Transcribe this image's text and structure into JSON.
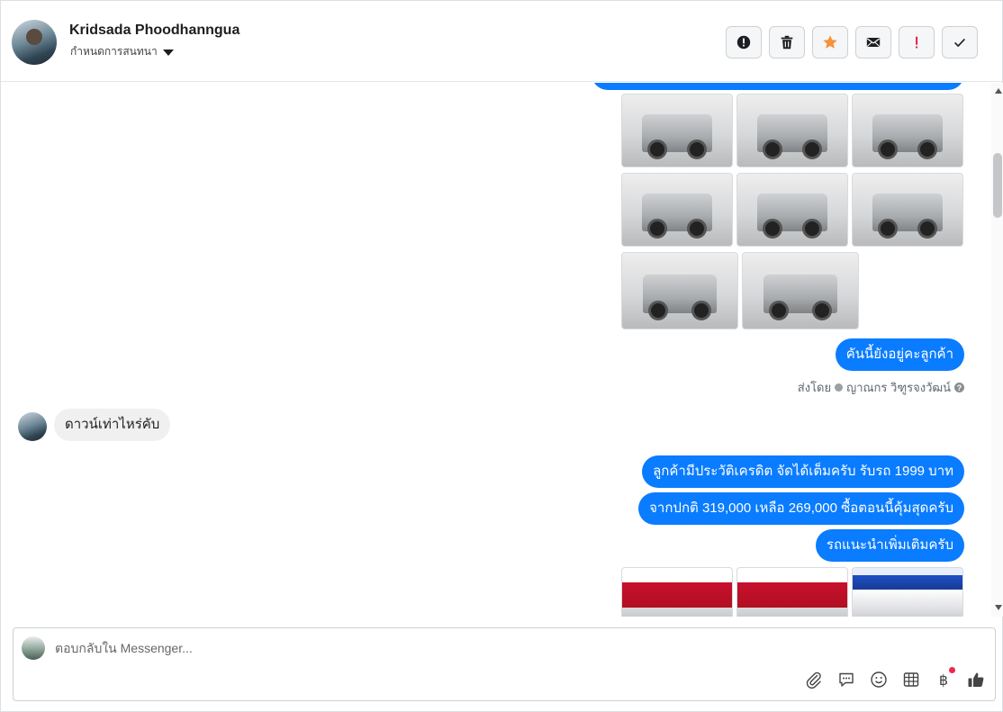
{
  "header": {
    "contact_name": "Kridsada Phoodhanngua",
    "status_label": "กำหนดการสนทนา",
    "actions": [
      {
        "name": "mark-spam-button",
        "icon": "alert-circle-icon",
        "color": "#1c1e21"
      },
      {
        "name": "delete-button",
        "icon": "trash-icon",
        "color": "#1c1e21"
      },
      {
        "name": "star-button",
        "icon": "star-icon",
        "color": "#f7923b"
      },
      {
        "name": "mark-unread-button",
        "icon": "envelope-icon",
        "color": "#1c1e21"
      },
      {
        "name": "mark-important-button",
        "icon": "exclamation-icon",
        "color": "#e41e3f"
      },
      {
        "name": "mark-done-button",
        "icon": "check-icon",
        "color": "#1c1e21"
      }
    ]
  },
  "messages": {
    "still_available": "คันนี้ยังอยู่คะลูกค้า",
    "sent_by_prefix": "ส่งโดย",
    "sent_by_name": "ญาณกร วิฑูรจงวัฒน์",
    "incoming_price_question": "ดาวน์เท่าไหร่คับ",
    "reply_1": "ลูกค้ามีประวัติเครดิต จัดได้เต็มครับ รับรถ 1999 บาท",
    "reply_2": "จากปกติ 319,000 เหลือ 269,000 ซื้อตอนนี้คุ้มสุดครับ",
    "reply_3": "รถแนะนำเพิ่มเติมครับ"
  },
  "composer": {
    "placeholder": "ตอบกลับใน Messenger...",
    "tools": [
      "attachment-icon",
      "saved-reply-icon",
      "emoji-icon",
      "table-icon",
      "baht-payment-icon",
      "like-icon"
    ],
    "baht_symbol": "฿"
  },
  "colors": {
    "outgoing_bubble": "#0a7cff",
    "incoming_bubble": "#f0f0f0",
    "star": "#f7923b",
    "important": "#e41e3f"
  }
}
